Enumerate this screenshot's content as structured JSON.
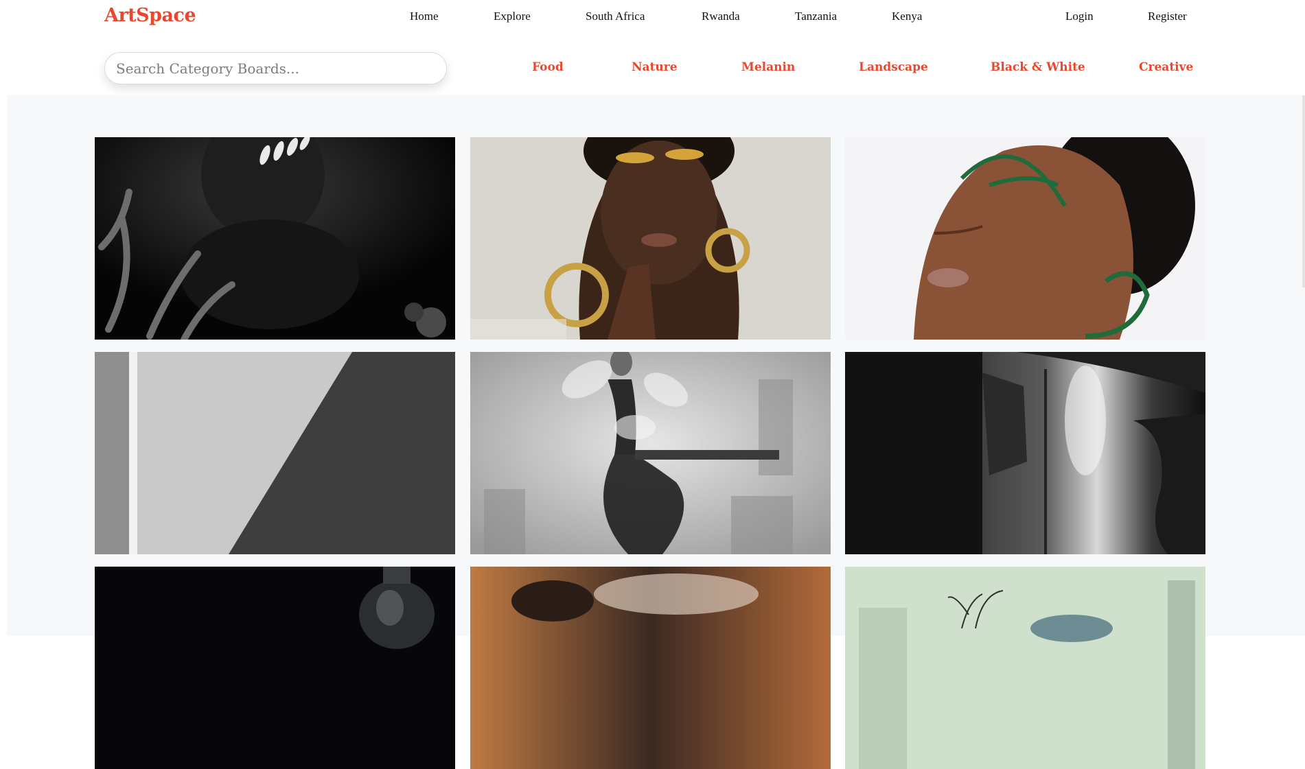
{
  "brand": {
    "name": "ArtSpace",
    "color": "#e8482f"
  },
  "nav": {
    "items": [
      "Home",
      "Explore",
      "South Africa",
      "Rwanda",
      "Tanzania",
      "Kenya"
    ],
    "login": "Login",
    "register": "Register"
  },
  "search": {
    "placeholder": "Search Category Boards..."
  },
  "categories": [
    "Food",
    "Nature",
    "Melanin",
    "Landscape",
    "Black & White",
    "Creative"
  ],
  "gallery": {
    "cards": [
      {
        "subject": "monochrome-portrait-white-face-paint"
      },
      {
        "subject": "portrait-gold-eyeshadow-hoop-earrings"
      },
      {
        "subject": "portrait-green-eyeliner-art"
      },
      {
        "subject": "bw-wall-shadow-diagonal"
      },
      {
        "subject": "bw-dancer-double-exposure-flowers"
      },
      {
        "subject": "bw-doorway-silhouette"
      },
      {
        "subject": "dark-still-life-glass-bottle"
      },
      {
        "subject": "smoky-fire-closeup"
      },
      {
        "subject": "pastel-glass-jars-plant"
      }
    ]
  }
}
